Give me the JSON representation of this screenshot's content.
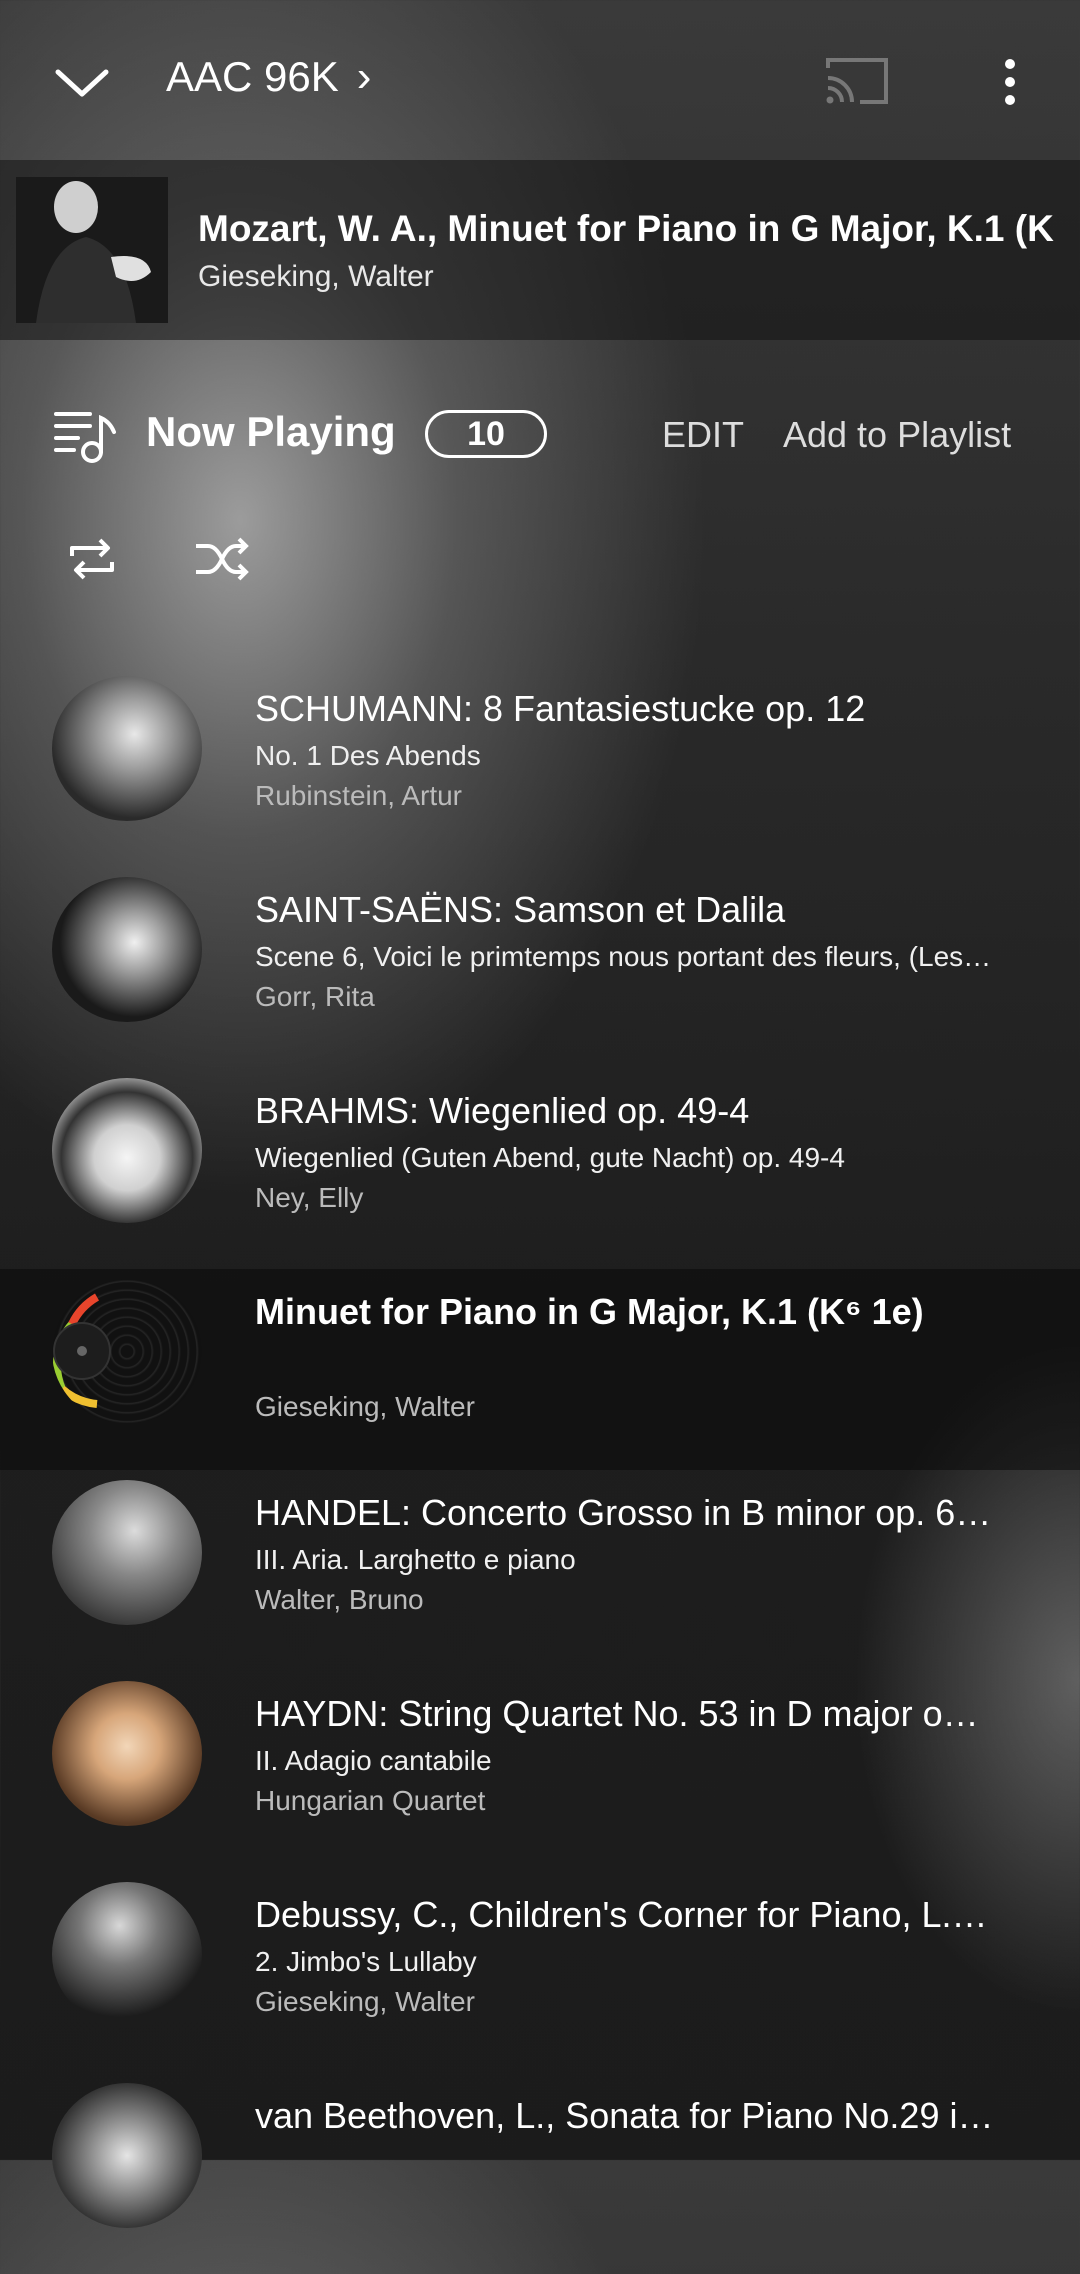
{
  "header": {
    "quality": "AAC 96K",
    "quality_arrow": "›"
  },
  "mini_player": {
    "title": "Mozart, W. A., Minuet for Piano in G Major, K.1 (K",
    "artist": "Gieseking, Walter"
  },
  "now_playing": {
    "title": "Now Playing",
    "count": "10",
    "edit_label": "EDIT",
    "add_label": "Add to Playlist"
  },
  "tracks": [
    {
      "title": "SCHUMANN: 8 Fantasiestucke op. 12",
      "subtitle": "No. 1 Des Abends",
      "artist": "Rubinstein, Artur",
      "current": false
    },
    {
      "title": "SAINT-SAËNS: Samson et Dalila",
      "subtitle": "Scene 6, Voici le primtemps nous portant des fleurs, (Les…",
      "artist": "Gorr, Rita",
      "current": false
    },
    {
      "title": "BRAHMS: Wiegenlied op. 49-4",
      "subtitle": "Wiegenlied (Guten Abend, gute Nacht) op. 49-4",
      "artist": "Ney, Elly",
      "current": false
    },
    {
      "title": "Minuet for Piano in G Major, K.1 (K⁶ 1e)",
      "subtitle": "",
      "artist": "Gieseking, Walter",
      "current": true
    },
    {
      "title": "HANDEL: Concerto Grosso in B minor op. 6…",
      "subtitle": "III. Aria. Larghetto e piano",
      "artist": "Walter, Bruno",
      "current": false
    },
    {
      "title": "HAYDN: String Quartet No. 53 in D major o…",
      "subtitle": "II. Adagio cantabile",
      "artist": "Hungarian Quartet",
      "current": false
    },
    {
      "title": "Debussy, C., Children's Corner for Piano, L.…",
      "subtitle": "2. Jimbo's Lullaby",
      "artist": "Gieseking, Walter",
      "current": false
    },
    {
      "title": "van Beethoven, L., Sonata for Piano No.29 i…",
      "subtitle": "",
      "artist": "",
      "current": false
    }
  ]
}
